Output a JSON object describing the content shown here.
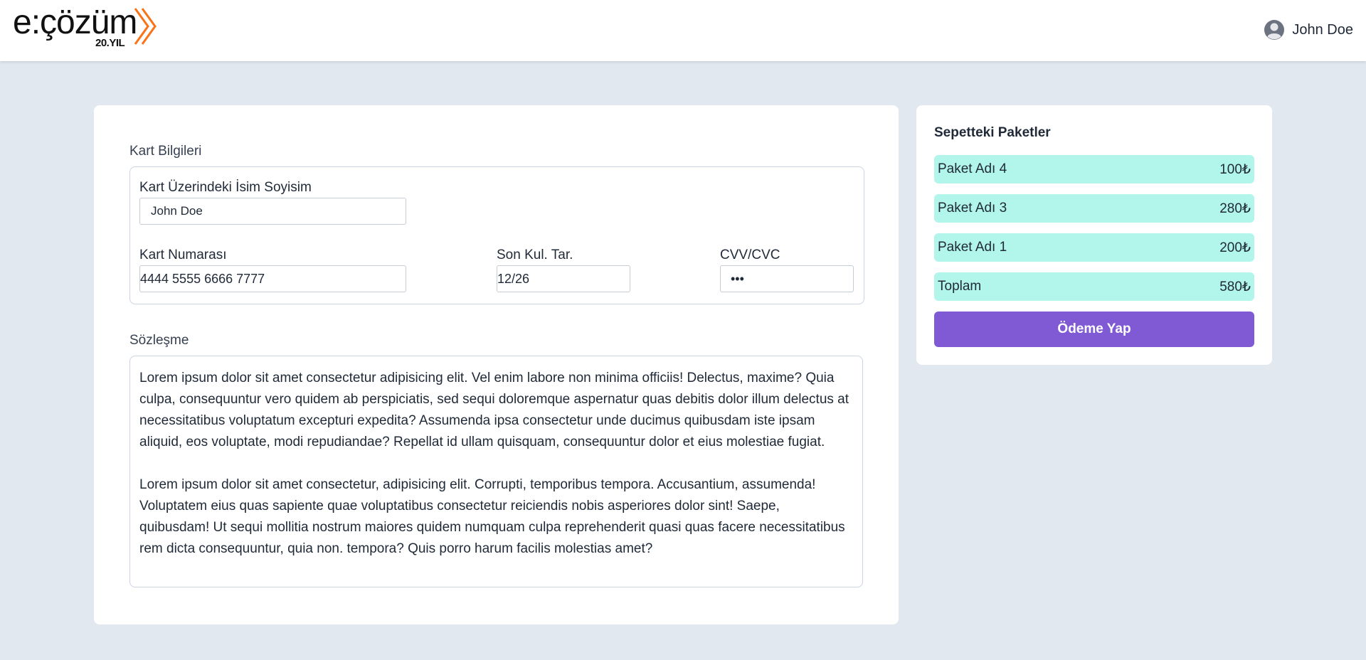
{
  "header": {
    "logo_text": "e:çözüm",
    "logo_sub": "20.YIL",
    "user_name": "John Doe",
    "accent": "#f97316"
  },
  "card_form": {
    "section_title": "Kart Bilgileri",
    "name_label": "Kart Üzerindeki İsim Soyisim",
    "name_value": "John Doe",
    "number_label": "Kart Numarası",
    "number_value": "4444 5555 6666 7777",
    "expiry_label": "Son Kul. Tar.",
    "expiry_value": "12/26",
    "cvv_label": "CVV/CVC",
    "cvv_value": "•••"
  },
  "contract": {
    "title": "Sözleşme",
    "paragraphs": [
      "Lorem ipsum dolor sit amet consectetur adipisicing elit. Vel enim labore non minima officiis! Delectus, maxime? Quia culpa, consequuntur vero quidem ab perspiciatis, sed sequi doloremque aspernatur quas debitis dolor illum delectus at necessitatibus voluptatum excepturi expedita? Assumenda ipsa consectetur unde ducimus quibusdam iste ipsam aliquid, eos voluptate, modi repudiandae? Repellat id ullam quisquam, consequuntur dolor et eius molestiae fugiat.",
      "Lorem ipsum dolor sit amet consectetur, adipisicing elit. Corrupti, temporibus tempora. Accusantium, assumenda! Voluptatem eius quas sapiente quae voluptatibus consectetur reiciendis nobis asperiores dolor sint! Saepe, quibusdam! Ut sequi mollitia nostrum maiores quidem numquam culpa reprehenderit quasi quas facere necessitatibus rem dicta consequuntur, quia non. tempora? Quis porro harum facilis molestias amet?"
    ]
  },
  "cart": {
    "title": "Sepetteki Paketler",
    "items": [
      {
        "name": "Paket Adı 4",
        "price": "100₺"
      },
      {
        "name": "Paket Adı 3",
        "price": "280₺"
      },
      {
        "name": "Paket Adı 1",
        "price": "200₺"
      }
    ],
    "total_label": "Toplam",
    "total_value": "580₺",
    "pay_label": "Ödeme Yap",
    "row_color": "#b2f5ea",
    "button_color": "#805ad5"
  }
}
